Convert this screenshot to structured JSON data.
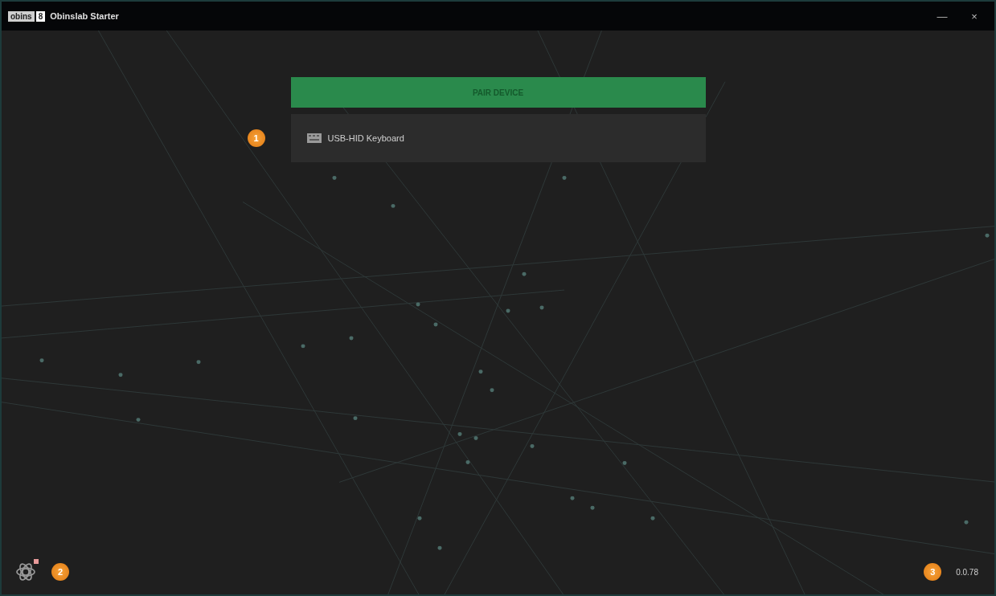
{
  "window": {
    "logo": "obins",
    "logo_badge": "8",
    "title": "Obinslab Starter",
    "controls": [
      "—",
      "×"
    ]
  },
  "pair_button": {
    "label": "PAIR DEVICE"
  },
  "devices": [
    {
      "name": "USB-HID Keyboard",
      "marker": "1"
    }
  ],
  "settings": {
    "notification": true,
    "marker": "2"
  },
  "version": {
    "text": "0.0.78",
    "marker": "3"
  }
}
